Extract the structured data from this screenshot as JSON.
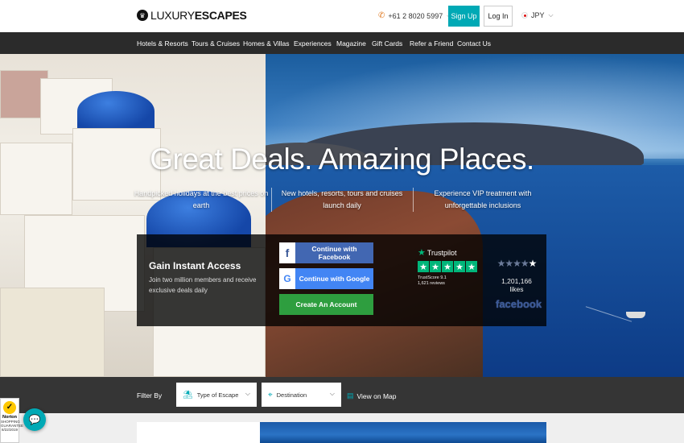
{
  "header": {
    "logo": {
      "light": "LUXURY",
      "bold": "ESCAPES",
      "icon": "logo-mark-icon"
    },
    "phone": "+61 2 8020 5997",
    "signup_label": "Sign Up",
    "login_label": "Log In",
    "currency": "JPY"
  },
  "nav": {
    "items": [
      "Hotels & Resorts",
      "Tours & Cruises",
      "Homes & Villas",
      "Experiences",
      "Magazine",
      "Gift Cards",
      "Refer a Friend",
      "Contact Us"
    ]
  },
  "hero": {
    "title": "Great Deals. Amazing Places.",
    "features": [
      {
        "line1": "Handpicked holidays at the best prices on",
        "line2": "earth"
      },
      {
        "line1": "New hotels, resorts, tours and cruises",
        "line2": "launch daily"
      },
      {
        "line1": "Experience VIP treatment with",
        "line2": "unforgettable inclusions"
      }
    ]
  },
  "signup_panel": {
    "title": "Gain Instant Access",
    "subtitle": "Join two million members and receive exclusive deals daily",
    "facebook_button": "Continue with Facebook",
    "google_button": "Continue with Google",
    "create_button": "Create An Account",
    "trustpilot": {
      "name": "Trustpilot",
      "score": "TrustScore 9.1",
      "reviews": "1,621 reviews"
    },
    "facebook_likes": {
      "count": "1,201,166 likes",
      "logo": "facebook",
      "rating_stars": 5
    }
  },
  "filter": {
    "label": "Filter By",
    "type_placeholder": "Type of Escape",
    "destination_placeholder": "Destination",
    "map_label": "View on Map"
  },
  "badges": {
    "norton_name": "Norton",
    "norton_line1": "SHOPPING",
    "norton_line2": "GUARANTEE",
    "norton_date": "8/22/2019"
  },
  "colors": {
    "accent": "#00a9b5",
    "nav_bg": "#2b2b2b",
    "facebook": "#4267b2",
    "google": "#4285f4",
    "create": "#2e9e3f",
    "trustpilot": "#00b67a"
  }
}
